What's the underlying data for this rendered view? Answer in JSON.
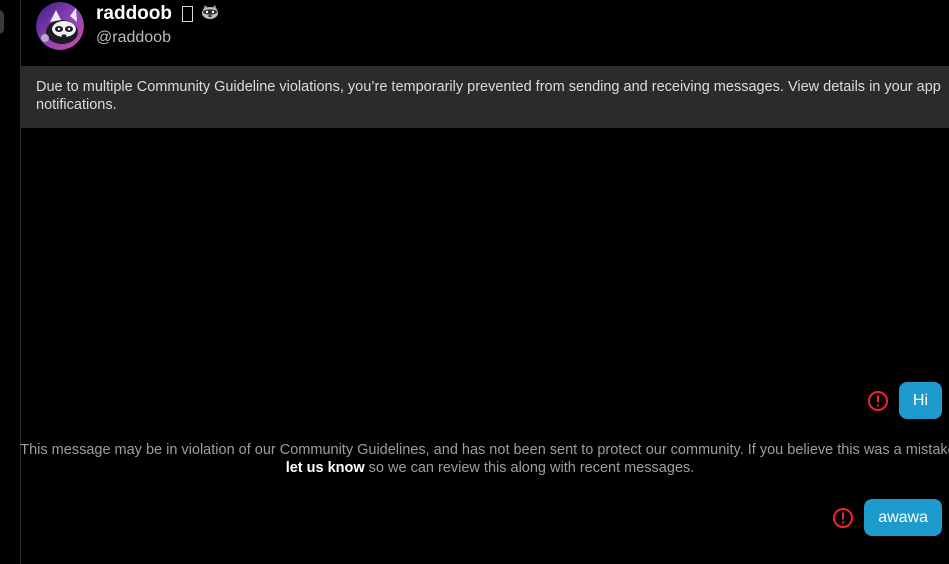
{
  "conversation": {
    "display_name": "raddoob",
    "handle": "@raddoob",
    "avatar_icon": "raccoon-avatar",
    "name_emoji_icon": "raccoon-icon"
  },
  "banner": {
    "text": "Due to multiple Community Guideline violations, you’re temporarily prevented from sending and receiving messages. View details in your app notifications."
  },
  "messages": [
    {
      "text": "Hi",
      "status_icon": "warning-icon"
    },
    {
      "text": "awawa",
      "status_icon": "warning-icon"
    }
  ],
  "violation_notice": {
    "before": "This message may be in violation of our Community Guidelines, and has not been sent to protect our community. If you believe this was a mistake, ",
    "link": "let us know",
    "after": " so we can review this along with recent messages."
  },
  "colors": {
    "background": "#000000",
    "banner": "#2b2b2b",
    "bubble": "#1d9bcc",
    "warning": "#f4212e"
  }
}
